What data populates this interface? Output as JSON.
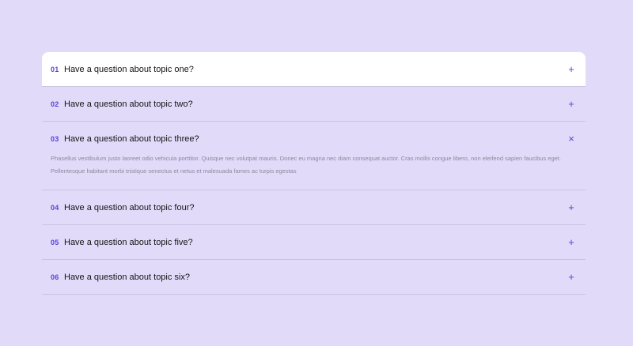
{
  "faq": {
    "items": [
      {
        "number": "01",
        "question": "Have a question about topic one?",
        "toggle": "+"
      },
      {
        "number": "02",
        "question": "Have a question about topic two?",
        "toggle": "+"
      },
      {
        "number": "03",
        "question": "Have a question about topic three?",
        "toggle": "×",
        "answer": "Phasellus vestibulum justo laoreet odio vehicula porttitor. Quisque nec volutpat mauris. Donec eu magna nec diam consequat auctor. Cras mollis congue libero, non eleifend sapien faucibus eget. Pellentesque habitant morbi tristique senectus et netus et malesuada fames ac turpis egestas"
      },
      {
        "number": "04",
        "question": "Have a question about topic four?",
        "toggle": "+"
      },
      {
        "number": "05",
        "question": "Have a question about topic five?",
        "toggle": "+"
      },
      {
        "number": "06",
        "question": "Have a question about topic six?",
        "toggle": "+"
      }
    ]
  },
  "colors": {
    "background": "#e2daf9",
    "accent": "#5b3fd6",
    "divider": "#cbc3e3",
    "answer_text": "#8a8a9a"
  }
}
